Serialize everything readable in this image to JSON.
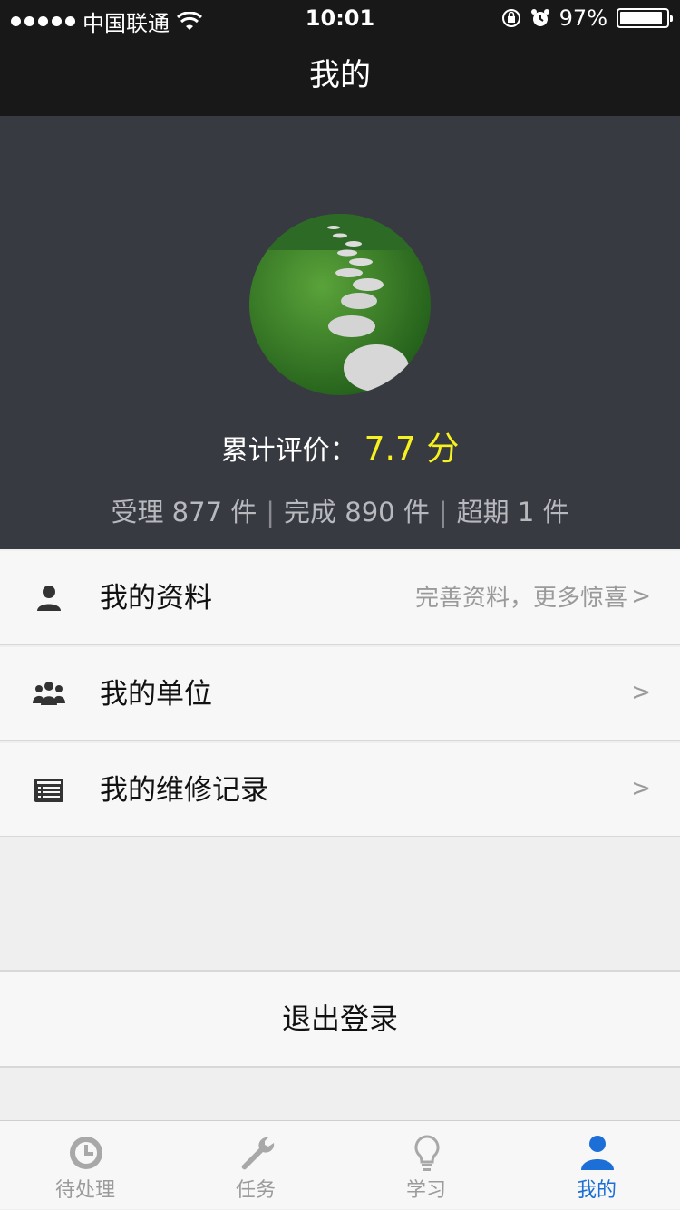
{
  "status_bar": {
    "carrier": "中国联通",
    "time": "10:01",
    "battery": "97%"
  },
  "nav": {
    "title": "我的"
  },
  "profile": {
    "rating_label": "累计评价：",
    "rating_value": "7.7 分",
    "stats": {
      "accepted": "受理 877 件",
      "completed": "完成 890 件",
      "overdue": "超期 1 件",
      "separator": "|"
    }
  },
  "menu": {
    "profile_label": "我的资料",
    "profile_hint": "完善资料，更多惊喜",
    "unit_label": "我的单位",
    "repair_label": "我的维修记录",
    "arrow": ">"
  },
  "logout_label": "退出登录",
  "tabbar": {
    "tabs": [
      {
        "label": "待处理",
        "icon": "clock-icon"
      },
      {
        "label": "任务",
        "icon": "wrench-icon"
      },
      {
        "label": "学习",
        "icon": "bulb-icon"
      },
      {
        "label": "我的",
        "icon": "person-icon"
      }
    ],
    "active_color": "#1b6fd6",
    "inactive_color": "#9b9b9b"
  },
  "colors": {
    "header_bg": "#181818",
    "profile_bg": "#383a42",
    "rating_accent": "#f7f21d"
  }
}
